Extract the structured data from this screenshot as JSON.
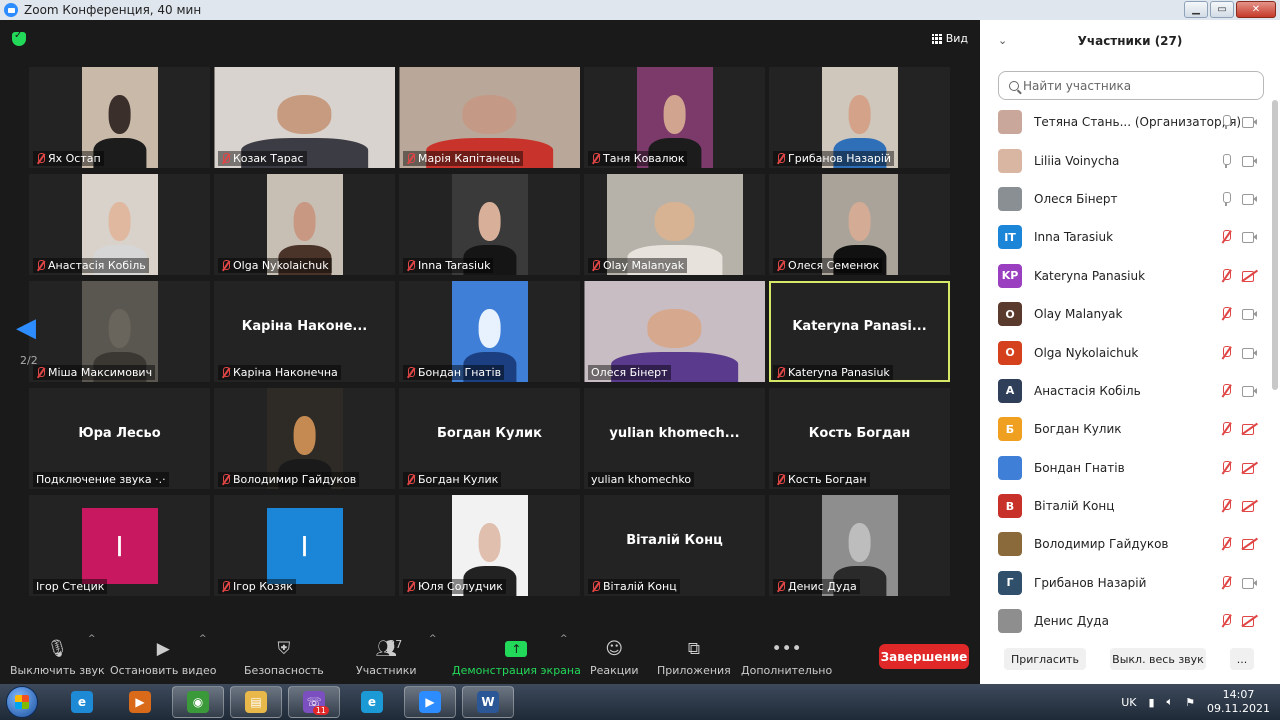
{
  "window": {
    "title": "Zoom Конференция, 40 мин"
  },
  "view_label": "Вид",
  "page_indicator": "2/2",
  "tiles": [
    {
      "name": "Ях Остап",
      "kind": "video",
      "mic_off": true,
      "colors": [
        "#c9b9a8",
        "#3a2f2a",
        "#1c1c1c"
      ]
    },
    {
      "name": "Козак Тарас",
      "kind": "video-wide",
      "mic_off": true,
      "colors": [
        "#d9d3cf",
        "#c79b7f",
        "#3c3c44"
      ]
    },
    {
      "name": "Марія Капітанець",
      "kind": "video-wide",
      "mic_off": true,
      "colors": [
        "#b9a89a",
        "#c49a86",
        "#c8342c"
      ]
    },
    {
      "name": "Таня Ковалюк",
      "kind": "video",
      "mic_off": true,
      "colors": [
        "#7b3a6a",
        "#d0a48f",
        "#1c1c1c"
      ]
    },
    {
      "name": "Грибанов Назарій",
      "kind": "video",
      "mic_off": true,
      "colors": [
        "#cfc6bc",
        "#d4a288",
        "#2f6fb8"
      ]
    },
    {
      "name": "Анастасія Кобіль",
      "kind": "video",
      "mic_off": true,
      "colors": [
        "#d8d2ca",
        "#e0b8a0",
        "#d6d6d6"
      ]
    },
    {
      "name": "Olga Nykolaichuk",
      "kind": "video",
      "mic_off": true,
      "colors": [
        "#c8bfb4",
        "#c99883",
        "#4a3328"
      ]
    },
    {
      "name": "Inna Tarasiuk",
      "kind": "video",
      "mic_off": true,
      "colors": [
        "#3a3a3a",
        "#d8b09a",
        "#151515"
      ]
    },
    {
      "name": "Olay Malanyak",
      "kind": "video-mid",
      "mic_off": true,
      "colors": [
        "#b6b2aa",
        "#d7b293",
        "#e8e2dc"
      ]
    },
    {
      "name": "Олеся Семенюк",
      "kind": "video",
      "mic_off": true,
      "colors": [
        "#aaa39a",
        "#d4ab95",
        "#111111"
      ]
    },
    {
      "name": "Міша Максимович",
      "kind": "video",
      "mic_off": true,
      "colors": [
        "#5a5650",
        "#6a655c",
        "#3b3834"
      ]
    },
    {
      "name": "Каріна Наконечна",
      "kind": "text",
      "big": "Каріна Наконе...",
      "mic_off": true
    },
    {
      "name": "Бондан Гнатів",
      "kind": "video",
      "mic_off": true,
      "colors": [
        "#3f7fd8",
        "#e8f2ff",
        "#1b3f80"
      ]
    },
    {
      "name": "Олеся Бінерт",
      "kind": "video-wide",
      "mic_off": false,
      "colors": [
        "#c9bdc4",
        "#d6a88e",
        "#5a3a8c"
      ]
    },
    {
      "name": "Kateryna Panasiuk",
      "kind": "text",
      "big": "Kateryna  Panasi...",
      "mic_off": true,
      "active": true
    },
    {
      "name": "Подключение звука ·.·",
      "kind": "text",
      "big": "Юра Лесьо",
      "mic_off": false
    },
    {
      "name": "Володимир Гайдуков",
      "kind": "video",
      "mic_off": true,
      "colors": [
        "#2e2a26",
        "#c48a52",
        "#1a1a1a"
      ]
    },
    {
      "name": "Богдан Кулик",
      "kind": "text",
      "big": "Богдан Кулик",
      "mic_off": true
    },
    {
      "name": "yulian khomechko",
      "kind": "text",
      "big": "yulian  khomech...",
      "mic_off": false
    },
    {
      "name": "Кость Богдан",
      "kind": "text",
      "big": "Кость Богдан",
      "mic_off": true
    },
    {
      "name": "Ігор Стецик",
      "kind": "avatar",
      "letter": "I",
      "color": "#c8185f",
      "mic_off": false
    },
    {
      "name": "Ігор Козяк",
      "kind": "avatar",
      "letter": "I",
      "color": "#1b86d8",
      "mic_off": true
    },
    {
      "name": "Юля Солудчик",
      "kind": "video",
      "mic_off": true,
      "colors": [
        "#f2f2f2",
        "#e0bfae",
        "#222222"
      ]
    },
    {
      "name": "Віталій Конц",
      "kind": "text",
      "big": "Віталій Конц",
      "mic_off": true
    },
    {
      "name": "Денис Дуда",
      "kind": "video",
      "mic_off": true,
      "colors": [
        "#8e8e8e",
        "#bdbdbd",
        "#2a2a2a"
      ]
    }
  ],
  "toolbar": {
    "mute": "Выключить звук",
    "video": "Остановить видео",
    "security": "Безопасность",
    "participants": "Участники",
    "participants_count": "27",
    "share": "Демонстрация экрана",
    "reactions": "Реакции",
    "apps": "Приложения",
    "more": "Дополнительно",
    "end": "Завершение"
  },
  "panel": {
    "title": "Участники (27)",
    "search_placeholder": "Найти участника",
    "participants": [
      {
        "name": "Тетяна Стань...  (Организатор, я)",
        "avatar": "",
        "color": "#c9a79a",
        "mic": "ok",
        "cam": "ok"
      },
      {
        "name": "Liliia Voinycha",
        "avatar": "",
        "color": "#d9b6a2",
        "mic": "ok",
        "cam": "ok"
      },
      {
        "name": "Олеся Бінерт",
        "avatar": "",
        "color": "#8a8f94",
        "mic": "ok",
        "cam": "ok"
      },
      {
        "name": "Inna Tarasiuk",
        "avatar": "IT",
        "color": "#1b86d8",
        "mic": "off",
        "cam": "ok"
      },
      {
        "name": "Kateryna Panasiuk",
        "avatar": "KP",
        "color": "#9a3fbf",
        "mic": "off",
        "cam": "off"
      },
      {
        "name": "Olay Malanyak",
        "avatar": "O",
        "color": "#5a3a2c",
        "mic": "off",
        "cam": "ok"
      },
      {
        "name": "Olga Nykolaichuk",
        "avatar": "O",
        "color": "#d4411c",
        "mic": "off",
        "cam": "ok"
      },
      {
        "name": "Анастасія Кобіль",
        "avatar": "A",
        "color": "#2f3f5a",
        "mic": "off",
        "cam": "ok"
      },
      {
        "name": "Богдан Кулик",
        "avatar": "Б",
        "color": "#f0a020",
        "mic": "off",
        "cam": "off"
      },
      {
        "name": "Бондан Гнатів",
        "avatar": "",
        "color": "#3f7fd8",
        "mic": "off",
        "cam": "off"
      },
      {
        "name": "Віталій Конц",
        "avatar": "В",
        "color": "#c8302a",
        "mic": "off",
        "cam": "off"
      },
      {
        "name": "Володимир Гайдуков",
        "avatar": "",
        "color": "#8a6a3a",
        "mic": "off",
        "cam": "off"
      },
      {
        "name": "Грибанов Назарій",
        "avatar": "Г",
        "color": "#2f4f6a",
        "mic": "off",
        "cam": "ok"
      },
      {
        "name": "Денис Дуда",
        "avatar": "",
        "color": "#8e8e8e",
        "mic": "off",
        "cam": "off"
      }
    ],
    "invite": "Пригласить",
    "mute_all": "Выкл. весь звук",
    "more": "..."
  },
  "taskbar": {
    "apps": [
      {
        "name": "ie",
        "label": "e",
        "color": "#1e8ad6",
        "open": false
      },
      {
        "name": "media",
        "label": "▶",
        "color": "#d86a1a",
        "open": false
      },
      {
        "name": "chrome",
        "label": "◉",
        "color": "#3a9a3a",
        "open": true
      },
      {
        "name": "explorer",
        "label": "▤",
        "color": "#e8b84a",
        "open": true
      },
      {
        "name": "viber",
        "label": "☏",
        "color": "#7b4fbf",
        "open": true,
        "badge": "11"
      },
      {
        "name": "edge",
        "label": "e",
        "color": "#1b9ad6",
        "open": false
      },
      {
        "name": "zoom",
        "label": "▶",
        "color": "#2d8cff",
        "open": true
      },
      {
        "name": "word",
        "label": "W",
        "color": "#2b5797",
        "open": true
      }
    ],
    "lang": "UK",
    "time": "14:07",
    "date": "09.11.2021"
  }
}
